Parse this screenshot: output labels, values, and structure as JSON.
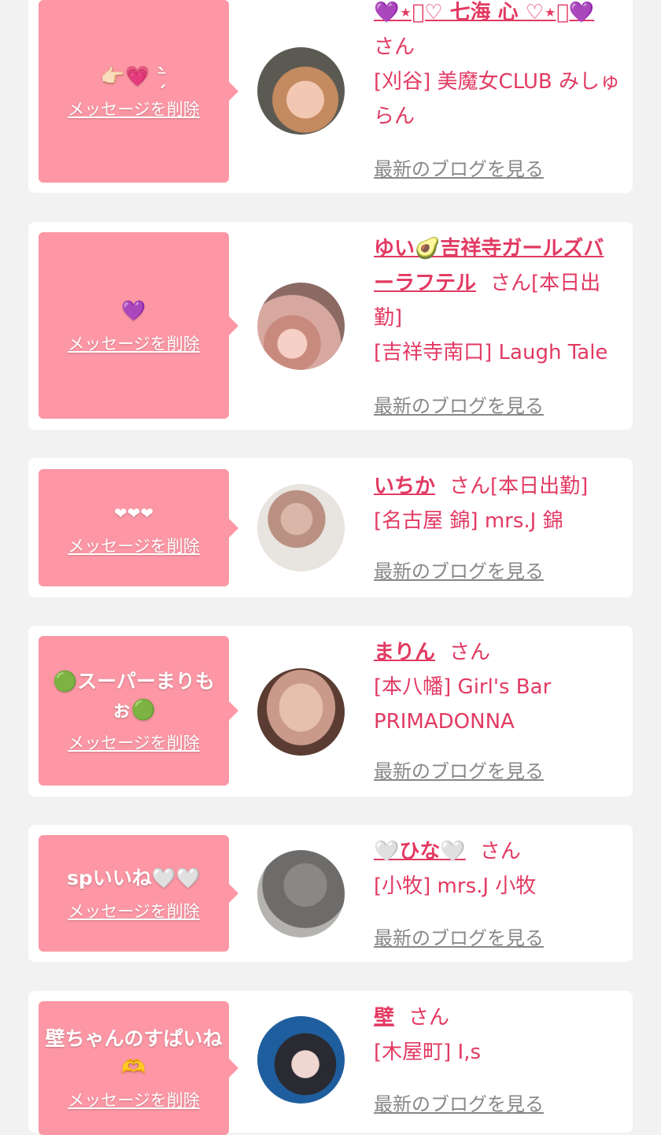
{
  "cards": [
    {
      "message": "👉🏻💗 ⁻̗̀ ",
      "delete_label": "メッセージを削除",
      "name": "💜⋆͛♡ 七海 心 ♡⋆͛💜",
      "honorific": "さん",
      "status": "",
      "shop": "[刈谷] 美魔女CLUB みしゅらん",
      "blog_label": "最新のブログを見る"
    },
    {
      "message": "💜",
      "delete_label": "メッセージを削除",
      "name": "ゆい🥑吉祥寺ガールズバーラフテル",
      "honorific": "さん",
      "status": "[本日出勤]",
      "shop": "[吉祥寺南口] Laugh Tale",
      "blog_label": "最新のブログを見る"
    },
    {
      "message": "❤❤❤",
      "delete_label": "メッセージを削除",
      "name": "いちか",
      "honorific": "さん",
      "status": "[本日出勤]",
      "shop": "[名古屋 錦] mrs.J 錦",
      "blog_label": "最新のブログを見る"
    },
    {
      "message": "🟢スーパーまりもぉ🟢",
      "delete_label": "メッセージを削除",
      "name": "まりん",
      "honorific": "さん",
      "status": "",
      "shop": "[本八幡] Girl's Bar PRIMADONNA",
      "blog_label": "最新のブログを見る"
    },
    {
      "message": "spいいね🤍🤍",
      "delete_label": "メッセージを削除",
      "name": "🤍ひな🤍",
      "honorific": "さん",
      "status": "",
      "shop": "[小牧] mrs.J 小牧",
      "blog_label": "最新のブログを見る"
    },
    {
      "message": "壁ちゃんのすぱいね🫶",
      "delete_label": "メッセージを削除",
      "name": "壁",
      "honorific": "さん",
      "status": "",
      "shop": "[木屋町] I,s",
      "blog_label": "最新のブログを見る"
    }
  ],
  "colors": {
    "page_background": "#f2f2f2",
    "card_background": "#ffffff",
    "bubble": "#fd97a5",
    "accent_pink": "#e23a62",
    "link_gray": "#888888"
  }
}
